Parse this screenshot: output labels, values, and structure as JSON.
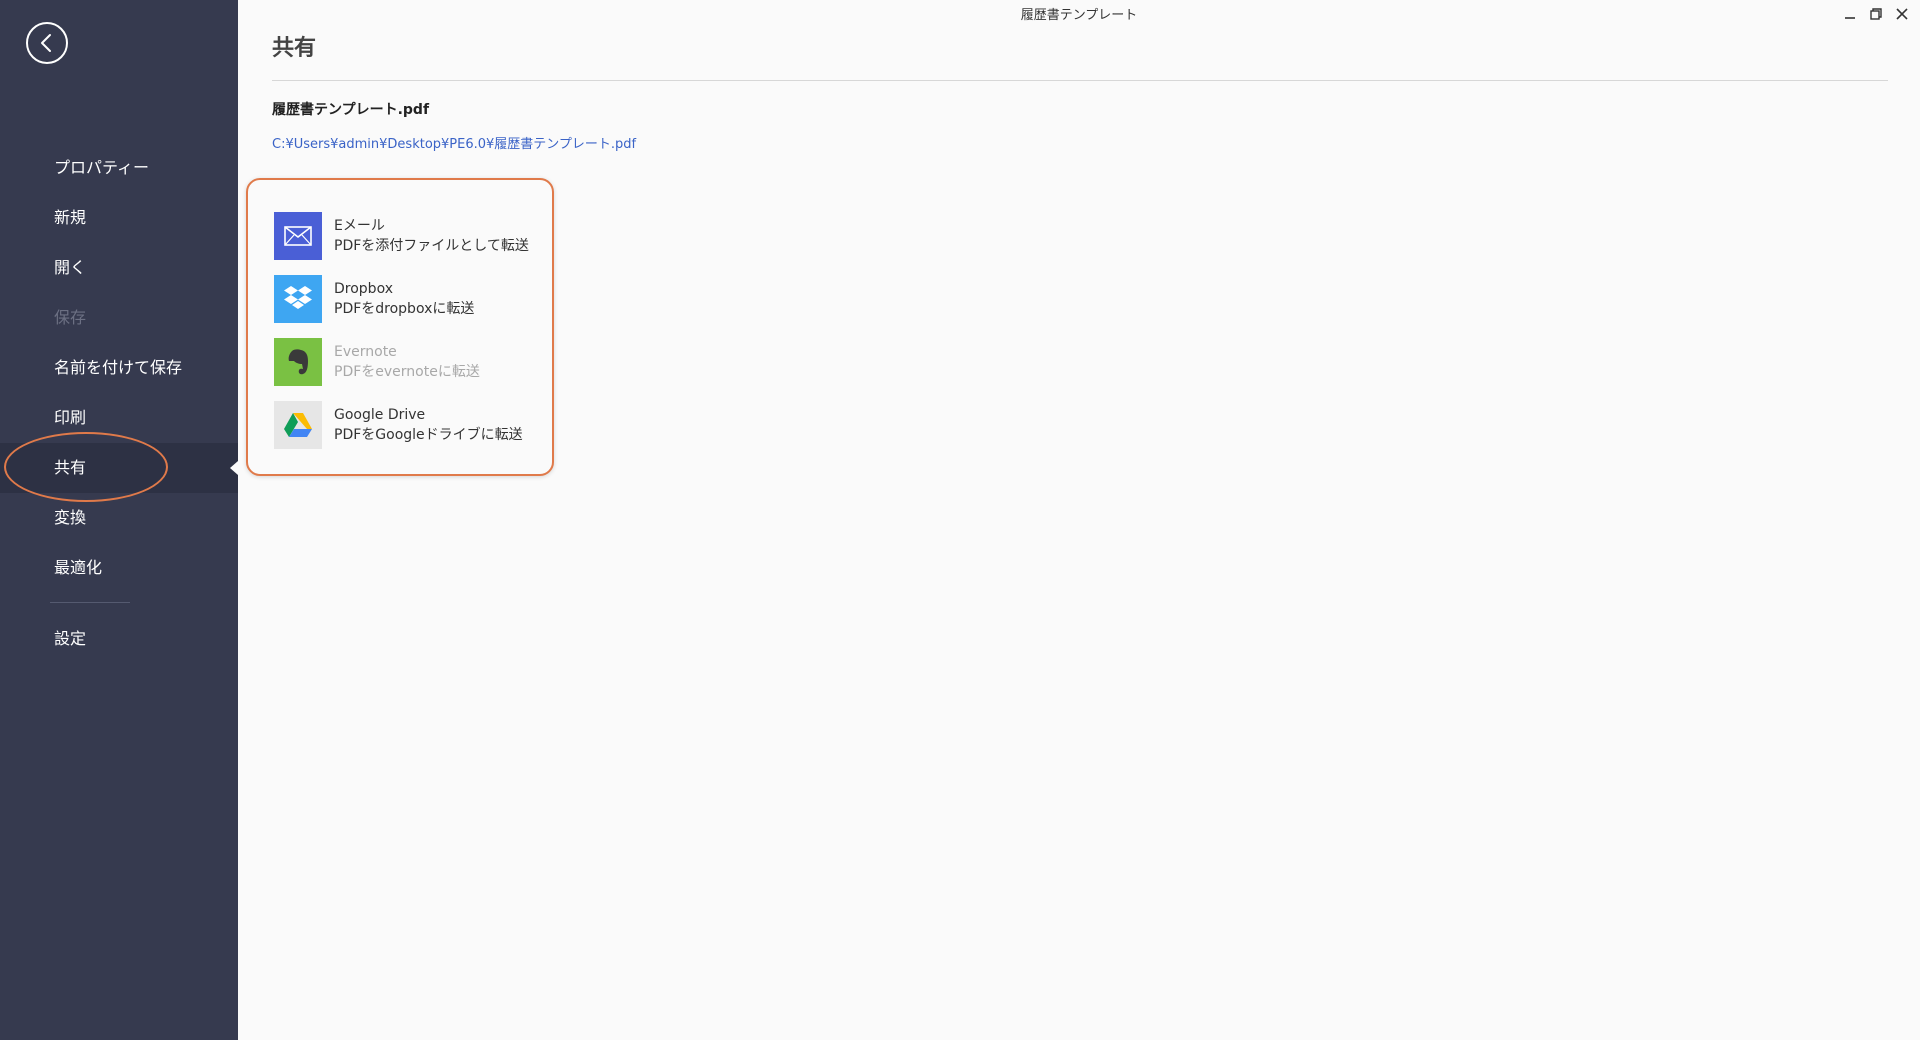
{
  "window": {
    "title": "履歴書テンプレート"
  },
  "sidebar": {
    "back_icon": "back-arrow-icon",
    "items": [
      {
        "label": "プロパティー",
        "state": "normal"
      },
      {
        "label": "新規",
        "state": "normal"
      },
      {
        "label": "開く",
        "state": "normal"
      },
      {
        "label": "保存",
        "state": "disabled"
      },
      {
        "label": "名前を付けて保存",
        "state": "normal"
      },
      {
        "label": "印刷",
        "state": "normal"
      },
      {
        "label": "共有",
        "state": "active"
      },
      {
        "label": "変換",
        "state": "normal"
      },
      {
        "label": "最適化",
        "state": "normal"
      }
    ],
    "settings_label": "設定",
    "colors": {
      "background": "#363a4f",
      "active_background": "#2d3144",
      "disabled_text": "#6c7083",
      "annotation": "#e07a4a"
    }
  },
  "main": {
    "title": "共有",
    "file_name": "履歴書テンプレート.pdf",
    "file_path": "C:¥Users¥admin¥Desktop¥PE6.0¥履歴書テンプレート.pdf",
    "share_options": [
      {
        "title": "Eメール",
        "description": "PDFを添付ファイルとして転送",
        "icon": "email-icon",
        "color": "#4a5fd6",
        "state": "enabled"
      },
      {
        "title": "Dropbox",
        "description": "PDFをdropboxに転送",
        "icon": "dropbox-icon",
        "color": "#3ea6f2",
        "state": "enabled"
      },
      {
        "title": "Evernote",
        "description": "PDFをevernoteに転送",
        "icon": "evernote-icon",
        "color": "#7ac143",
        "state": "disabled"
      },
      {
        "title": "Google Drive",
        "description": "PDFをGoogleドライブに転送",
        "icon": "google-drive-icon",
        "color": "#e6e6e6",
        "state": "enabled"
      }
    ]
  }
}
